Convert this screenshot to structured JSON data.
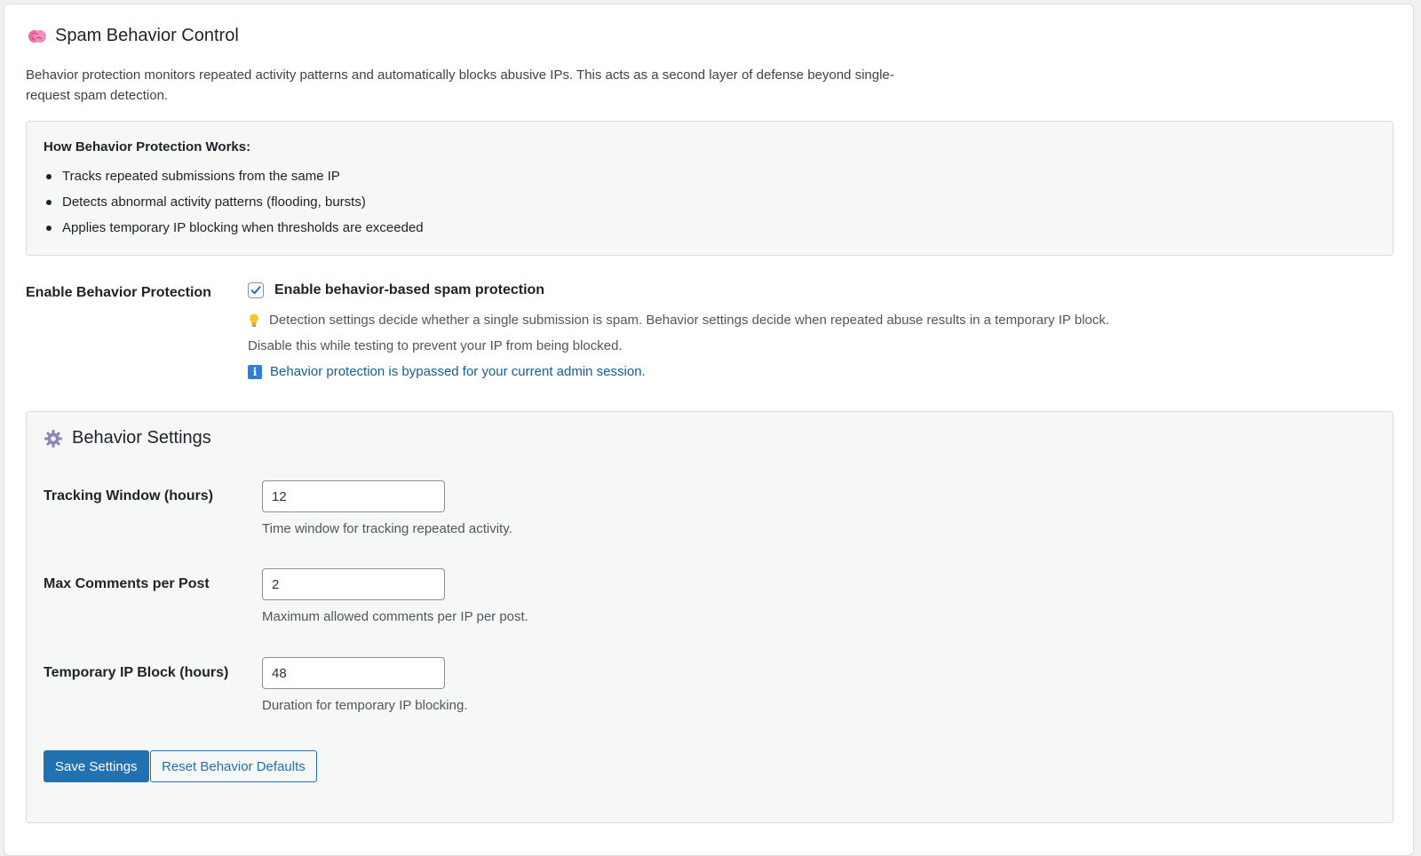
{
  "header": {
    "title": "Spam Behavior Control",
    "icon": "brain-icon",
    "description": "Behavior protection monitors repeated activity patterns and automatically blocks abusive IPs. This acts as a second layer of defense beyond single-request spam detection."
  },
  "how_it_works": {
    "title": "How Behavior Protection Works:",
    "items": [
      "Tracks repeated submissions from the same IP",
      "Detects abnormal activity patterns (flooding, bursts)",
      "Applies temporary IP blocking when thresholds are exceeded"
    ]
  },
  "enable": {
    "label": "Enable Behavior Protection",
    "checkbox_label": "Enable behavior-based spam protection",
    "checked": true,
    "hint": "Detection settings decide whether a single submission is spam. Behavior settings decide when repeated abuse results in a temporary IP block.",
    "testing_note": "Disable this while testing to prevent your IP from being blocked.",
    "admin_note": "Behavior protection is bypassed for your current admin session."
  },
  "settings": {
    "title": "Behavior Settings",
    "icon": "gear-icon",
    "fields": [
      {
        "label": "Tracking Window (hours)",
        "value": "12",
        "description": "Time window for tracking repeated activity."
      },
      {
        "label": "Max Comments per Post",
        "value": "2",
        "description": "Maximum allowed comments per IP per post."
      },
      {
        "label": "Temporary IP Block (hours)",
        "value": "48",
        "description": "Duration for temporary IP blocking."
      }
    ],
    "save_label": "Save Settings",
    "reset_label": "Reset Behavior Defaults"
  },
  "colors": {
    "primary": "#2271b1",
    "link": "#135e96",
    "panel_bg": "#f6f7f7",
    "border": "#dcdcde"
  }
}
